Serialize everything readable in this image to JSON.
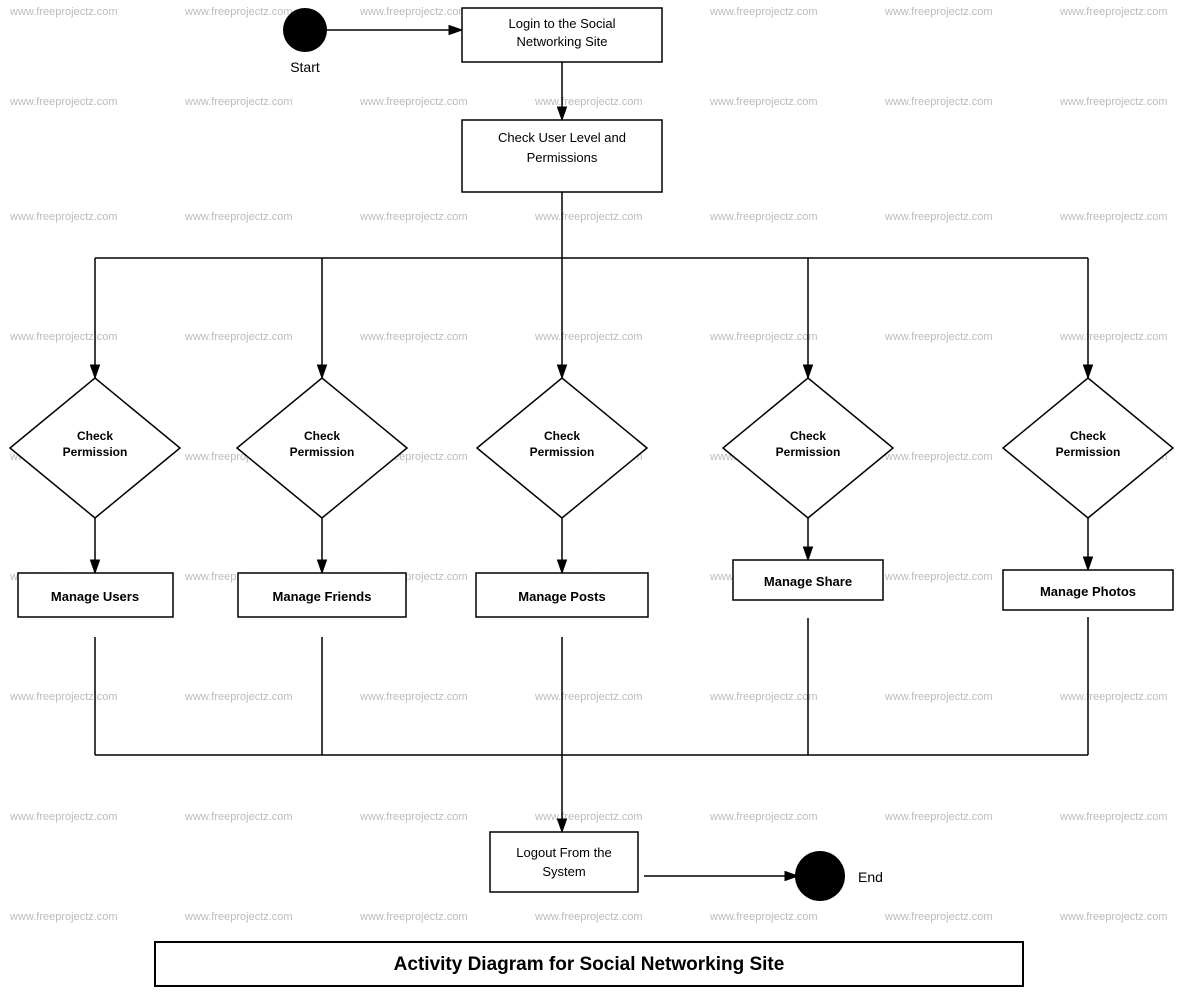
{
  "diagram": {
    "title": "Activity Diagram for Social Networking Site",
    "nodes": {
      "start_label": "Start",
      "end_label": "End",
      "login": "Login to the Social Networking Site",
      "check_user_level": "Check User Level and Permissions",
      "check_permission_1": "Check\nPermission",
      "check_permission_2": "Check\nPermission",
      "check_permission_3": "Check\nPermission",
      "check_permission_4": "Check\nPermission",
      "check_permission_5": "Check\nPermission",
      "manage_users": "Manage Users",
      "manage_friends": "Manage Friends",
      "manage_posts": "Manage Posts",
      "manage_share": "Manage Share",
      "manage_photos": "Manage Photos",
      "logout": "Logout From the System"
    },
    "watermark": "www.freeprojectz.com"
  }
}
